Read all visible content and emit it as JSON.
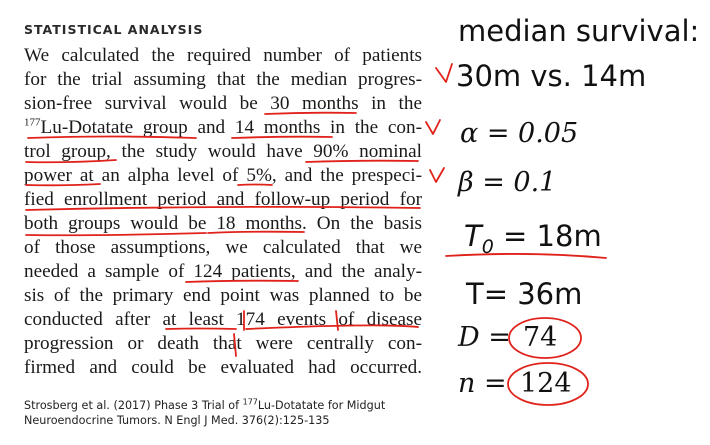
{
  "article": {
    "heading": "STATISTICAL ANALYSIS",
    "lines": [
      [
        {
          "t": "We calculated the required number of patients"
        }
      ],
      [
        {
          "t": "for the trial assuming that the median progres-"
        }
      ],
      [
        {
          "t": "sion-free survival would be 30 months in the"
        }
      ],
      [
        {
          "t": "177",
          "sup": true
        },
        {
          "t": "Lu-Dotatate group and 14 months in the con-"
        }
      ],
      [
        {
          "t": "trol group, the study would have 90% nominal"
        }
      ],
      [
        {
          "t": "power at an alpha level of 5%, and the prespeci-"
        }
      ],
      [
        {
          "t": "fied enrollment period and follow-up period for"
        }
      ],
      [
        {
          "t": "both groups would be 18 months. On the basis"
        }
      ],
      [
        {
          "t": "of those assumptions, we calculated that we"
        }
      ],
      [
        {
          "t": "needed a sample of 124 patients, and the analy-"
        }
      ],
      [
        {
          "t": "sis of the primary end point was planned to be"
        }
      ],
      [
        {
          "t": "conducted after at least 174 events of disease"
        }
      ],
      [
        {
          "t": "progression or death that were centrally con-"
        }
      ],
      [
        {
          "t": "firmed and could be evaluated had occurred."
        }
      ]
    ],
    "citation": {
      "line1_pre": "Strosberg et al. (2017) Phase 3 Trial of ",
      "line1_sup": "177",
      "line1_post": "Lu-Dotatate for Midgut",
      "line2": "Neuroendocrine Tumors. N Engl J Med. 376(2):125-135"
    }
  },
  "notes": {
    "title": "median survival:",
    "survival": "30m vs. 14m",
    "alpha": "α = 0.05",
    "beta": "β = 0.1",
    "t0_main": "T",
    "t0_sub": "0",
    "t0_rest": " = 18m",
    "t": "T= 36m",
    "d_label": "D =",
    "d_value": "74",
    "n_label": "n =",
    "n_value": "124"
  },
  "colors": {
    "ink": "#e0221b"
  }
}
